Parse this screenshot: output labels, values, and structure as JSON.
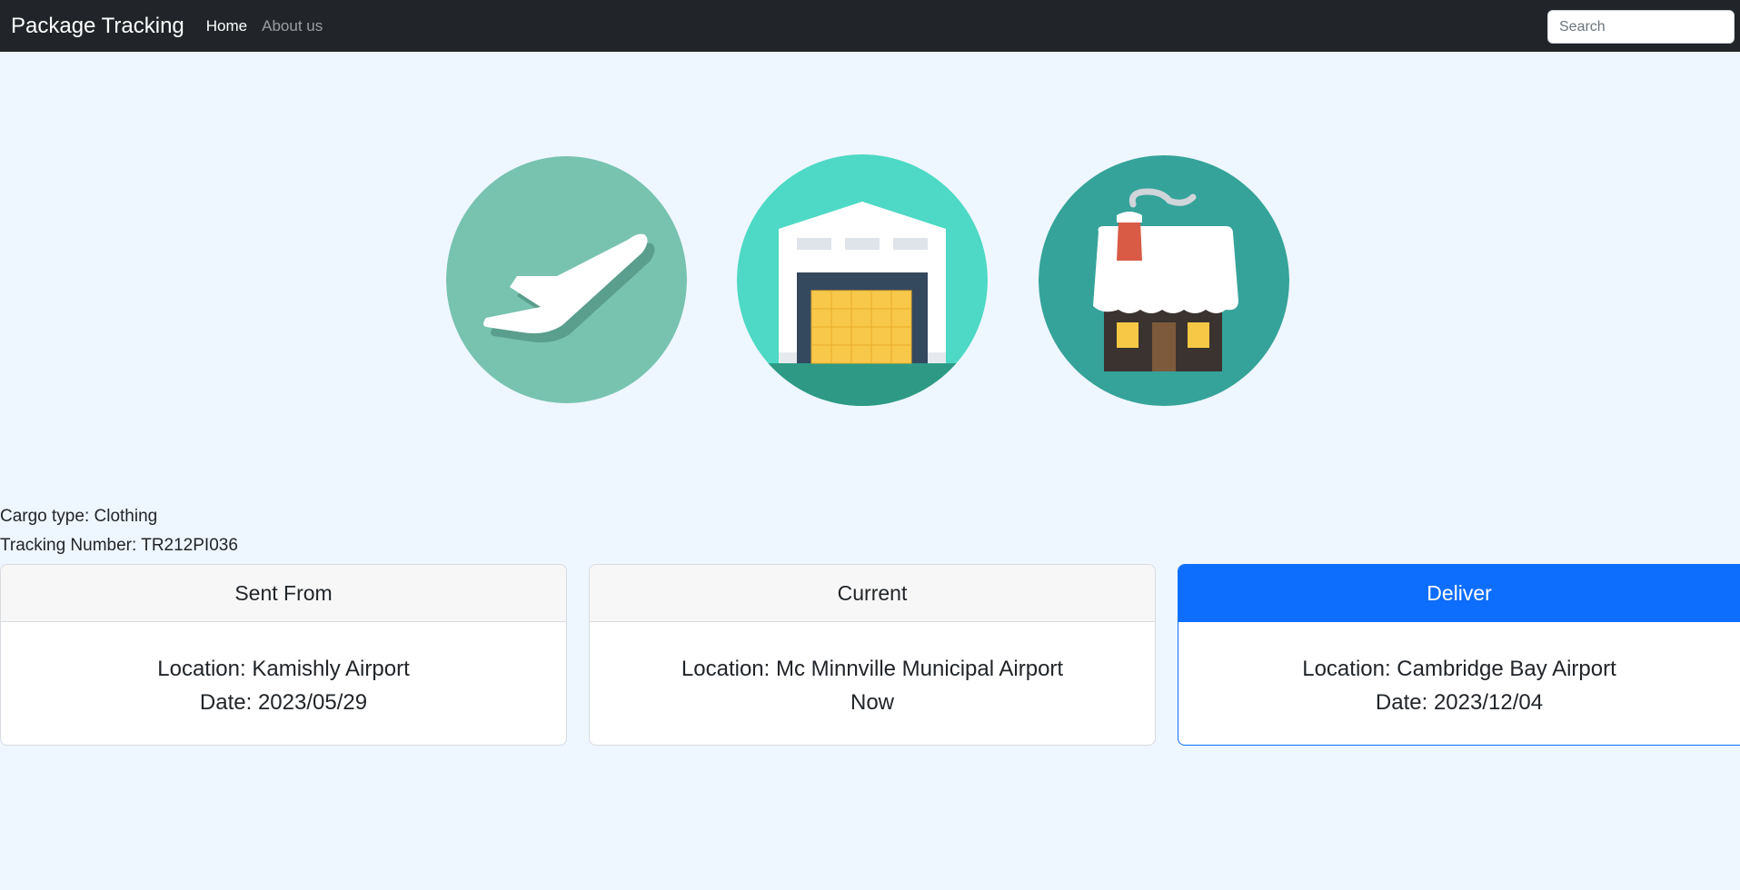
{
  "navbar": {
    "brand": "Package Tracking",
    "links": [
      {
        "label": "Home",
        "active": true
      },
      {
        "label": "About us",
        "active": false
      }
    ],
    "search_placeholder": "Search"
  },
  "stages": {
    "icons": [
      "airplane-icon",
      "warehouse-icon",
      "house-icon"
    ]
  },
  "shipment": {
    "cargo_type": "Cargo type: Clothing",
    "tracking_number": "Tracking Number: TR212PI036"
  },
  "cards": [
    {
      "header": "Sent From",
      "location": "Location: Kamishly Airport",
      "detail": "Date: 2023/05/29",
      "highlighted": false
    },
    {
      "header": "Current",
      "location": "Location: Mc Minnville Municipal Airport",
      "detail": "Now",
      "highlighted": false
    },
    {
      "header": "Deliver",
      "location": "Location: Cambridge Bay Airport",
      "detail": "Date: 2023/12/04",
      "highlighted": true
    }
  ],
  "colors": {
    "navbar": "#212529",
    "page_background": "#eef6ff",
    "primary": "#0d6efd",
    "airplane_circle": "#78c3b0",
    "warehouse_circle": "#4dd9c5",
    "house_circle": "#35a39a"
  }
}
